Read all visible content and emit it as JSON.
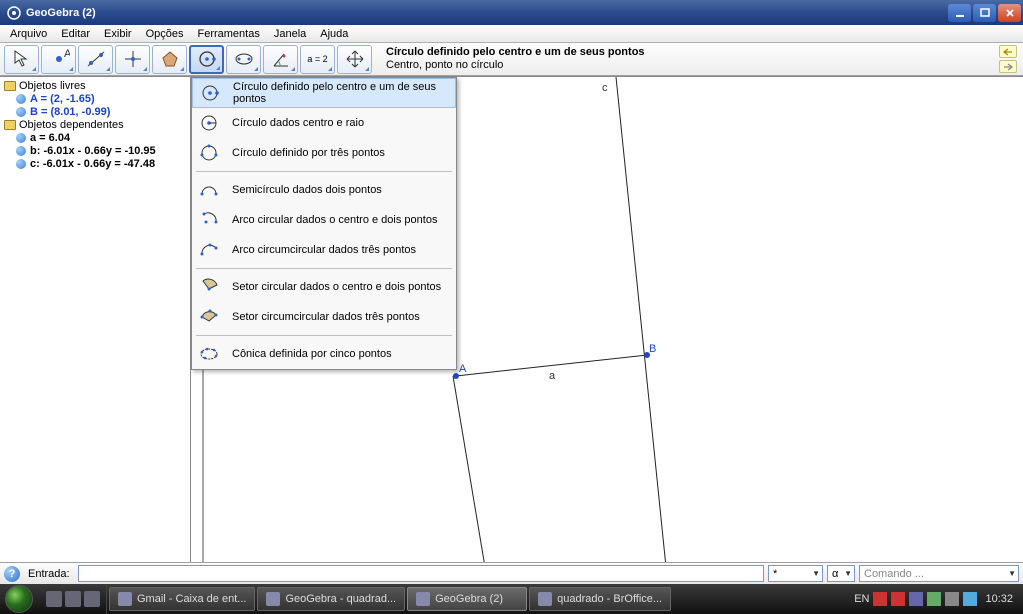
{
  "titlebar": {
    "title": "GeoGebra (2)"
  },
  "menu": {
    "items": [
      "Arquivo",
      "Editar",
      "Exibir",
      "Opções",
      "Ferramentas",
      "Janela",
      "Ajuda"
    ]
  },
  "toolbar": {
    "desc_title": "Círculo definido pelo centro e um de seus pontos",
    "desc_sub": "Centro, ponto no círculo",
    "abc_label": "a = 2"
  },
  "tree": {
    "free_label": "Objetos livres",
    "dep_label": "Objetos dependentes",
    "A": "A = (2, -1.65)",
    "B": "B = (8.01, -0.99)",
    "a": "a = 6.04",
    "b": "b: -6.01x - 0.66y = -10.95",
    "c": "c: -6.01x - 0.66y = -47.48"
  },
  "dropdown": {
    "items": [
      "Círculo definido pelo centro e um de seus pontos",
      "Círculo dados centro e raio",
      "Círculo definido por três pontos",
      "Semicírculo dados dois pontos",
      "Arco circular dados o centro e dois pontos",
      "Arco circumcircular dados três pontos",
      "Setor circular dados o centro e dois pontos",
      "Setor circumcircular dados três pontos",
      "Cônica definida por cinco pontos"
    ]
  },
  "graph": {
    "pointA": "A",
    "pointB": "B",
    "seg_a": "a",
    "line_c": "c"
  },
  "inputbar": {
    "label": "Entrada:",
    "symbol": "α",
    "command_placeholder": "Comando ...",
    "star": "*"
  },
  "taskbar": {
    "btn1": "Gmail - Caixa de ent...",
    "btn2": "GeoGebra - quadrad...",
    "btn3": "GeoGebra (2)",
    "btn4": "quadrado - BrOffice...",
    "lang": "EN",
    "time": "10:32"
  }
}
